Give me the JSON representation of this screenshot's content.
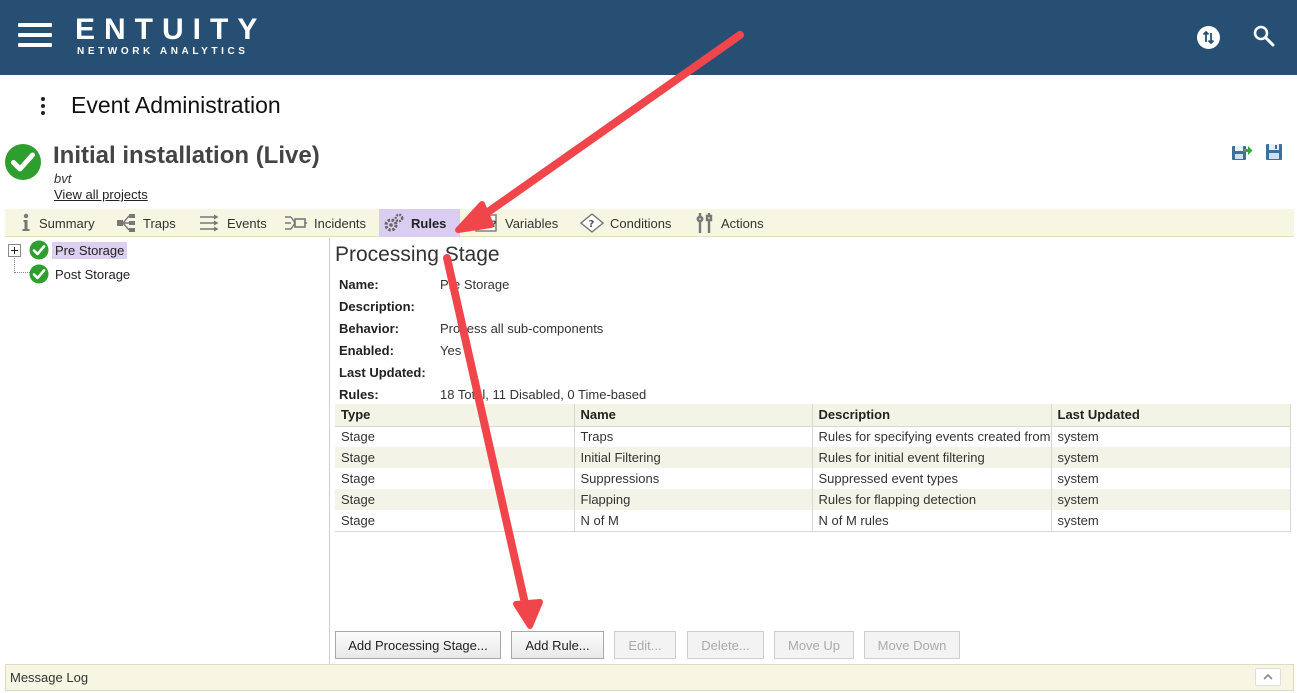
{
  "app": {
    "brand_name": "ENTUITY",
    "brand_sub": "NETWORK ANALYTICS",
    "header_bg": "#274f73"
  },
  "page": {
    "title": "Event Administration"
  },
  "project": {
    "title": "Initial installation (Live)",
    "subtitle": "bvt",
    "view_all_link": "View all projects"
  },
  "tabs": [
    {
      "label": "Summary",
      "icon": "info-icon"
    },
    {
      "label": "Traps",
      "icon": "traps-icon"
    },
    {
      "label": "Events",
      "icon": "events-icon"
    },
    {
      "label": "Incidents",
      "icon": "incidents-icon"
    },
    {
      "label": "Rules",
      "icon": "gears-icon",
      "active": true
    },
    {
      "label": "Variables",
      "icon": "variables-icon"
    },
    {
      "label": "Conditions",
      "icon": "conditions-icon"
    },
    {
      "label": "Actions",
      "icon": "actions-icon"
    }
  ],
  "tree": {
    "items": [
      {
        "label": "Pre Storage",
        "selected": true
      },
      {
        "label": "Post Storage",
        "selected": false
      }
    ]
  },
  "stage": {
    "title": "Processing Stage",
    "props": [
      {
        "key": "Name:",
        "value": "Pre Storage"
      },
      {
        "key": "Description:",
        "value": ""
      },
      {
        "key": "Behavior:",
        "value": "Process all sub-components"
      },
      {
        "key": "Enabled:",
        "value": "Yes"
      },
      {
        "key": "Last Updated:",
        "value": ""
      },
      {
        "key": "Rules:",
        "value": "18 Total, 11 Disabled, 0 Time-based"
      }
    ]
  },
  "table": {
    "columns": [
      "Type",
      "Name",
      "Description",
      "Last Updated"
    ],
    "rows": [
      [
        "Stage",
        "Traps",
        "Rules for specifying events created from traps",
        "system"
      ],
      [
        "Stage",
        "Initial Filtering",
        "Rules for initial event filtering",
        "system"
      ],
      [
        "Stage",
        "Suppressions",
        "Suppressed event types",
        "system"
      ],
      [
        "Stage",
        "Flapping",
        "Rules for flapping detection",
        "system"
      ],
      [
        "Stage",
        "N of M",
        "N of M rules",
        "system"
      ]
    ]
  },
  "buttons": {
    "add_stage": "Add Processing Stage...",
    "add_rule": "Add Rule...",
    "edit": "Edit...",
    "delete": "Delete...",
    "move_up": "Move Up",
    "move_down": "Move Down"
  },
  "message_log": {
    "label": "Message Log"
  },
  "colors": {
    "accent_active_tab": "#d9cdf2",
    "annotation_arrow": "#f0464b",
    "ok_green": "#2e9e2e"
  }
}
